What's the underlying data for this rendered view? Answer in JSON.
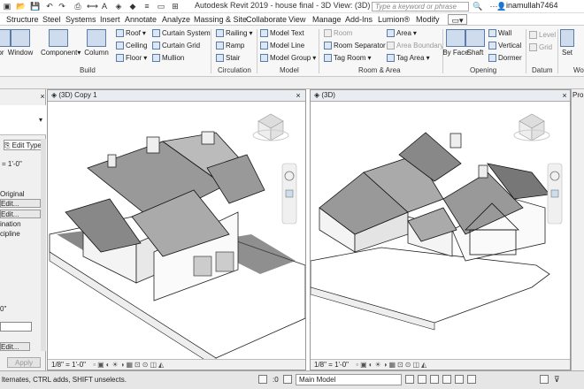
{
  "title_bar": {
    "title": "Autodesk Revit 2019 - house final - 3D View: (3D) Copy 1",
    "search_placeholder": "Type a keyword or phrase",
    "user": "inamullah7464"
  },
  "tabs": [
    {
      "label": "Structure"
    },
    {
      "label": "Steel"
    },
    {
      "label": "Systems"
    },
    {
      "label": "Insert"
    },
    {
      "label": "Annotate"
    },
    {
      "label": "Analyze"
    },
    {
      "label": "Massing & Site"
    },
    {
      "label": "Collaborate"
    },
    {
      "label": "View"
    },
    {
      "label": "Manage"
    },
    {
      "label": "Add-Ins"
    },
    {
      "label": "Lumion®"
    },
    {
      "label": "Modify"
    }
  ],
  "ribbon": {
    "build": {
      "label": "Build",
      "window": "Window",
      "component": "Component",
      "column": "Column",
      "door_partial": "or",
      "roof": "Roof",
      "ceiling": "Ceiling",
      "floor": "Floor",
      "curtain_system": "Curtain System",
      "curtain_grid": "Curtain Grid",
      "mullion": "Mullion"
    },
    "circulation": {
      "label": "Circulation",
      "railing": "Railing",
      "ramp": "Ramp",
      "stair": "Stair"
    },
    "model": {
      "label": "Model",
      "model_text": "Model Text",
      "model_line": "Model Line",
      "model_group": "Model Group"
    },
    "room_area": {
      "label": "Room & Area",
      "room": "Room",
      "room_separator": "Room Separator",
      "tag_room": "Tag Room",
      "area": "Area",
      "area_boundary": "Area Boundary",
      "tag_area": "Tag Area"
    },
    "opening": {
      "label": "Opening",
      "by_face": "By Face",
      "shaft": "Shaft",
      "wall": "Wall",
      "vertical": "Vertical",
      "dormer": "Dormer"
    },
    "datum": {
      "label": "Datum",
      "level": "Level",
      "grid": "Grid",
      "set": "Set"
    },
    "work_partial": "Wo"
  },
  "left_panel": {
    "edit_type": "Edit Type",
    "scale_value": "= 1'-0\"",
    "original": "Original",
    "edit1": "Edit...",
    "edit2": "Edit...",
    "ination": "ination",
    "cipline": "cipline",
    "zero": "0\"",
    "edit3": "Edit...",
    "apply": "Apply"
  },
  "views": {
    "left": {
      "tab": "(3D) Copy 1",
      "scale": "1/8\" = 1'-0\""
    },
    "right": {
      "tab": "(3D)",
      "scale": "1/8\" = 1'-0\""
    }
  },
  "right_strip": {
    "label": "Pro"
  },
  "status_bar": {
    "text": "lternates, CTRL adds, SHIFT unselects.",
    "zero": ":0",
    "model": "Main Model"
  },
  "colors": {
    "accent": "#1e5aa8",
    "ribbon_bg": "#f7f7f7",
    "tab_active": "#eef3fa"
  }
}
